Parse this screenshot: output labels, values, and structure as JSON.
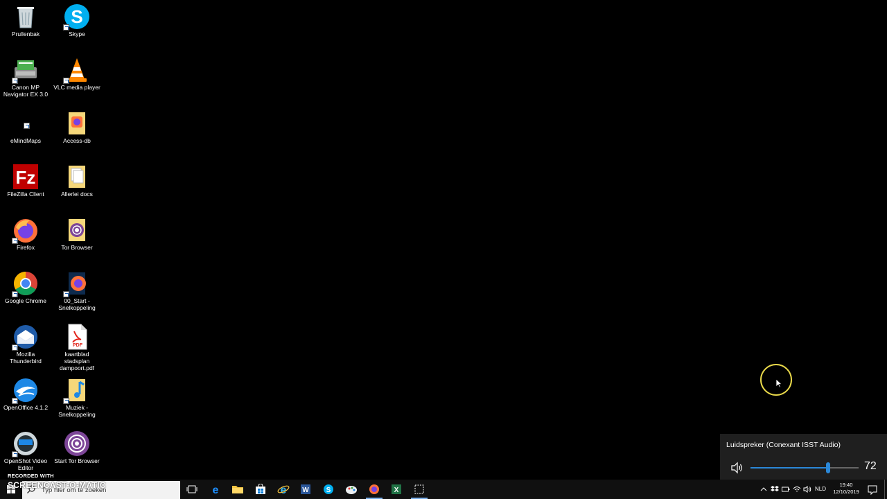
{
  "desktop": {
    "column1": [
      {
        "label": "Prullenbak",
        "icon": "recycle-bin-icon"
      },
      {
        "label": "Canon MP Navigator EX 3.0",
        "icon": "canon-navigator-icon"
      },
      {
        "label": "eMindMaps",
        "icon": "emindmaps-icon"
      },
      {
        "label": "FileZilla Client",
        "icon": "filezilla-icon"
      },
      {
        "label": "Firefox",
        "icon": "firefox-icon"
      },
      {
        "label": "Google Chrome",
        "icon": "chrome-icon"
      },
      {
        "label": "Mozilla Thunderbird",
        "icon": "thunderbird-icon"
      },
      {
        "label": "OpenOffice 4.1.2",
        "icon": "openoffice-icon"
      },
      {
        "label": "OpenShot Video Editor",
        "icon": "openshot-icon"
      }
    ],
    "column2": [
      {
        "label": "Skype",
        "icon": "skype-icon"
      },
      {
        "label": "VLC media player",
        "icon": "vlc-icon"
      },
      {
        "label": "Access-db",
        "icon": "access-folder-icon"
      },
      {
        "label": "Allerlei docs",
        "icon": "folder-docs-icon"
      },
      {
        "label": "Tor Browser",
        "icon": "tor-folder-icon"
      },
      {
        "label": "00_Start - Snelkoppeling",
        "icon": "firefox-shortcut-icon"
      },
      {
        "label": "kaartblad stadsplan dampoort.pdf",
        "icon": "pdf-icon"
      },
      {
        "label": "Muziek - Snelkoppeling",
        "icon": "music-folder-icon"
      },
      {
        "label": "Start Tor Browser",
        "icon": "tor-browser-icon"
      }
    ]
  },
  "volume": {
    "device": "Luidspreker (Conexant ISST Audio)",
    "level": 72,
    "level_text": "72"
  },
  "watermark": {
    "top": "RECORDED WITH",
    "main": "SCREENCAST-O-MATIC"
  },
  "taskbar": {
    "search_placeholder": "Typ hier om te zoeken",
    "apps": [
      "task-view",
      "edge",
      "file-explorer",
      "store",
      "ie",
      "word",
      "skype",
      "paint",
      "firefox",
      "excel",
      "snipping-tool"
    ],
    "language": "NLD",
    "time": "19:40",
    "date": "12/10/2019"
  },
  "colors": {
    "accent": "#2b88d8",
    "cursor_ring": "#e8d84a"
  }
}
